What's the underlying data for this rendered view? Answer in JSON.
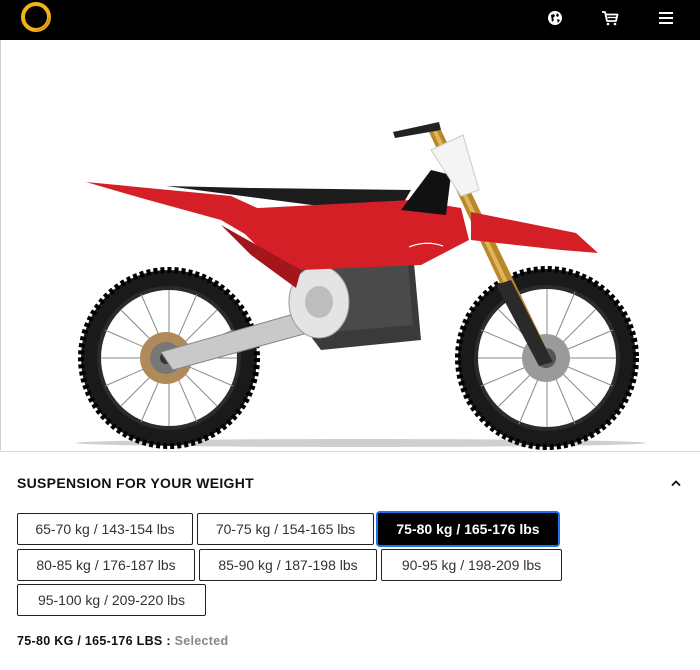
{
  "header": {
    "logo": "ring-logo",
    "icons": [
      "globe-icon",
      "cart-icon",
      "hamburger-menu-icon"
    ]
  },
  "hero": {
    "image": "red electric dirt bike"
  },
  "section": {
    "title": "SUSPENSION FOR YOUR WEIGHT",
    "options": [
      {
        "label": "65-70 kg / 143-154 lbs",
        "selected": false
      },
      {
        "label": "70-75 kg / 154-165 lbs",
        "selected": false
      },
      {
        "label": "75-80 kg / 165-176 lbs",
        "selected": true
      },
      {
        "label": "80-85 kg / 176-187 lbs",
        "selected": false
      },
      {
        "label": "85-90 kg / 187-198 lbs",
        "selected": false
      },
      {
        "label": "90-95 kg / 198-209 lbs",
        "selected": false
      },
      {
        "label": "95-100 kg / 209-220 lbs",
        "selected": false
      }
    ]
  },
  "summary": {
    "value": "75-80 KG / 165-176 LBS",
    "separator": " : ",
    "state": "Selected"
  },
  "colors": {
    "accent": "#1a73e8",
    "bike_red": "#d51f26",
    "logo_gold": "#f2b21b"
  }
}
